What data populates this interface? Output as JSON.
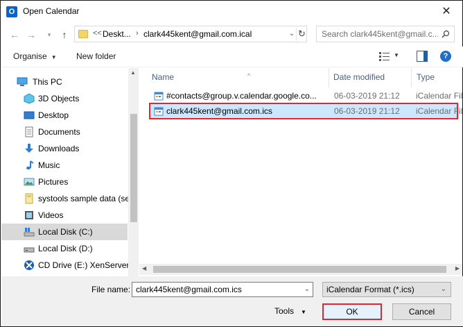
{
  "window": {
    "title": "Open Calendar"
  },
  "address": {
    "breadcrumbs": [
      "Deskt...",
      "clark445kent@gmail.com.ical"
    ],
    "overflow": "<<"
  },
  "search": {
    "placeholder": "Search clark445kent@gmail.c..."
  },
  "toolbar": {
    "organise": "Organise",
    "new_folder": "New folder"
  },
  "nav": {
    "items": [
      {
        "label": "This PC",
        "icon": "this-pc-icon",
        "selected": false
      },
      {
        "label": "3D Objects",
        "icon": "3d-objects-icon",
        "selected": false
      },
      {
        "label": "Desktop",
        "icon": "desktop-icon",
        "selected": false
      },
      {
        "label": "Documents",
        "icon": "documents-icon",
        "selected": false
      },
      {
        "label": "Downloads",
        "icon": "downloads-icon",
        "selected": false
      },
      {
        "label": "Music",
        "icon": "music-icon",
        "selected": false
      },
      {
        "label": "Pictures",
        "icon": "pictures-icon",
        "selected": false
      },
      {
        "label": "systools sample data (se",
        "icon": "folder-icon",
        "selected": false
      },
      {
        "label": "Videos",
        "icon": "videos-icon",
        "selected": false
      },
      {
        "label": "Local Disk (C:)",
        "icon": "local-disk-icon",
        "selected": true
      },
      {
        "label": "Local Disk (D:)",
        "icon": "local-disk-icon",
        "selected": false
      },
      {
        "label": "CD Drive (E:) XenServer T",
        "icon": "cd-drive-icon",
        "selected": false
      }
    ]
  },
  "columns": {
    "name": "Name",
    "date": "Date modified",
    "type": "Type"
  },
  "files": [
    {
      "name": "#contacts@group.v.calendar.google.co...",
      "date": "06-03-2019 21:12",
      "type": "iCalendar File",
      "selected": false
    },
    {
      "name": "clark445kent@gmail.com.ics",
      "date": "06-03-2019 21:12",
      "type": "iCalendar File",
      "selected": true
    }
  ],
  "footer": {
    "file_name_label": "File name:",
    "file_name_value": "clark445kent@gmail.com.ics",
    "filter": "iCalendar Format (*.ics)",
    "tools": "Tools",
    "ok": "OK",
    "cancel": "Cancel"
  },
  "colors": {
    "highlight": "#e0262e",
    "selection": "#cce8ff",
    "nav_selection": "#d9d9d9",
    "accent": "#1f6fc5"
  }
}
